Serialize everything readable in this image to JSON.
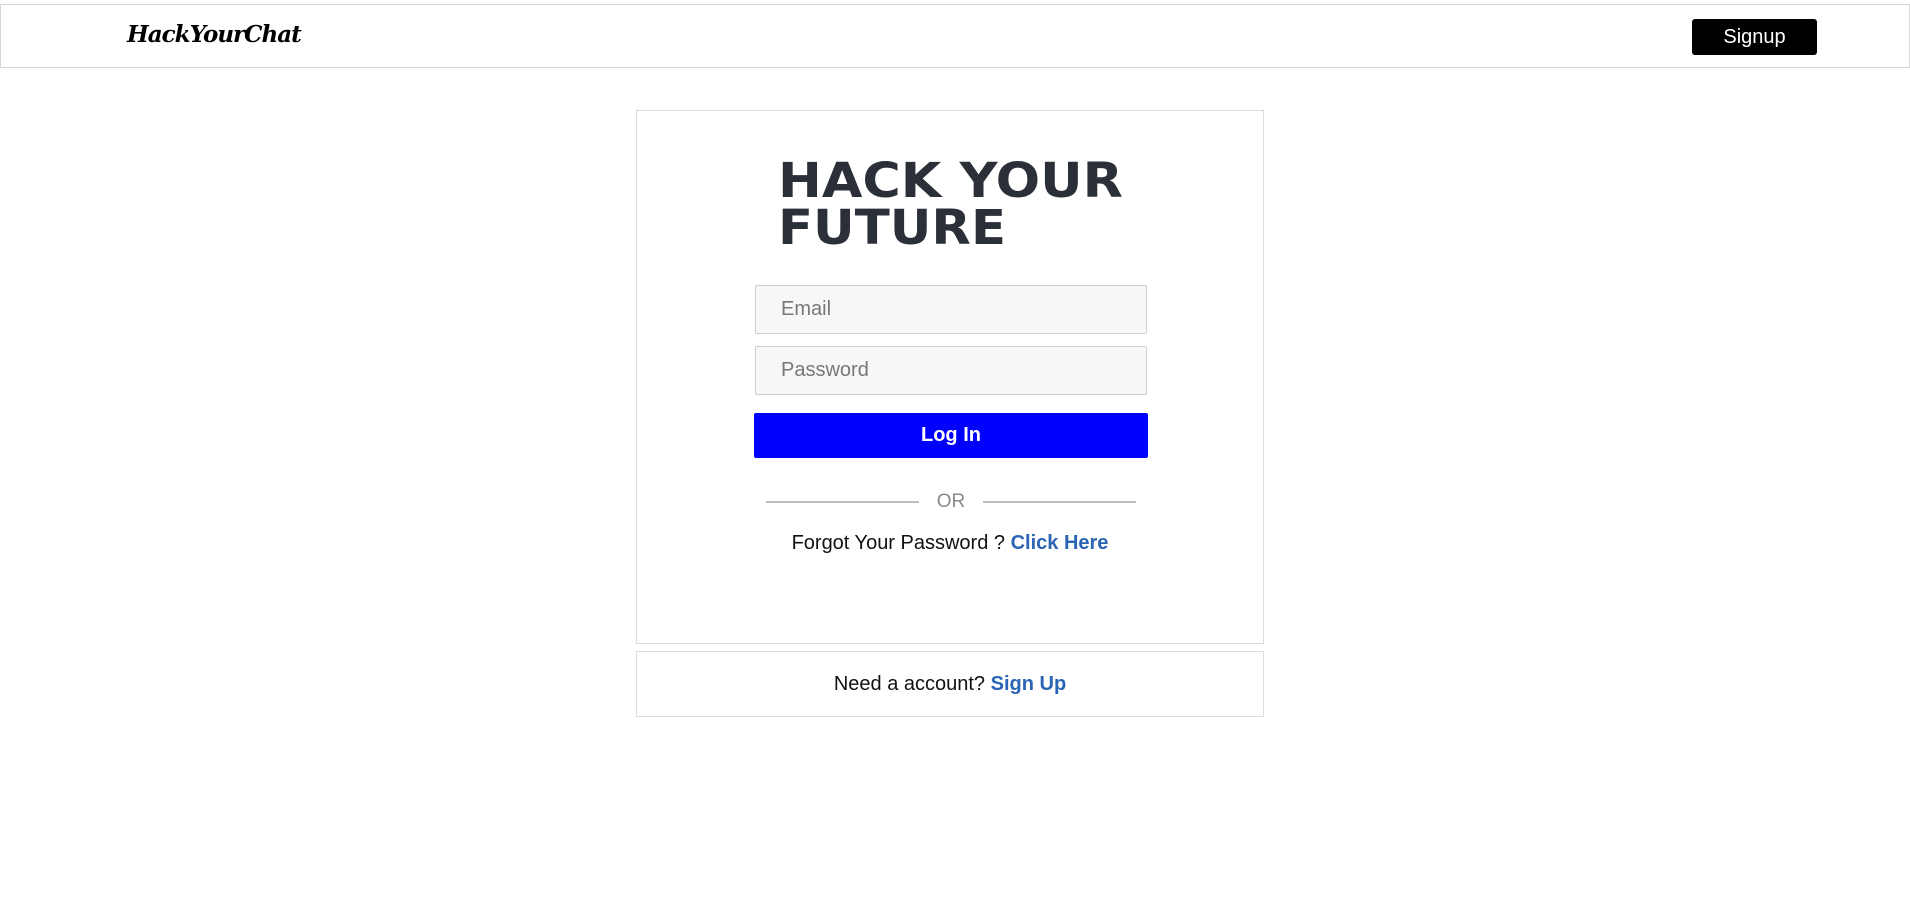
{
  "navbar": {
    "brand": "HackYourChat",
    "signup_label": "Signup"
  },
  "login": {
    "logo": {
      "line1": "HACK YOUR",
      "line2": "FUTURE",
      "color": "#2b2f38"
    },
    "email_placeholder": "Email",
    "password_placeholder": "Password",
    "login_label": "Log In",
    "divider_text": "OR",
    "forgot_text": "Forgot Your Password ?",
    "forgot_link": "Click Here"
  },
  "account": {
    "text": "Need a account?",
    "link": "Sign Up"
  },
  "colors": {
    "primary_button": "#0000ff",
    "link": "#2a64b5",
    "navbar_button": "#000000"
  }
}
